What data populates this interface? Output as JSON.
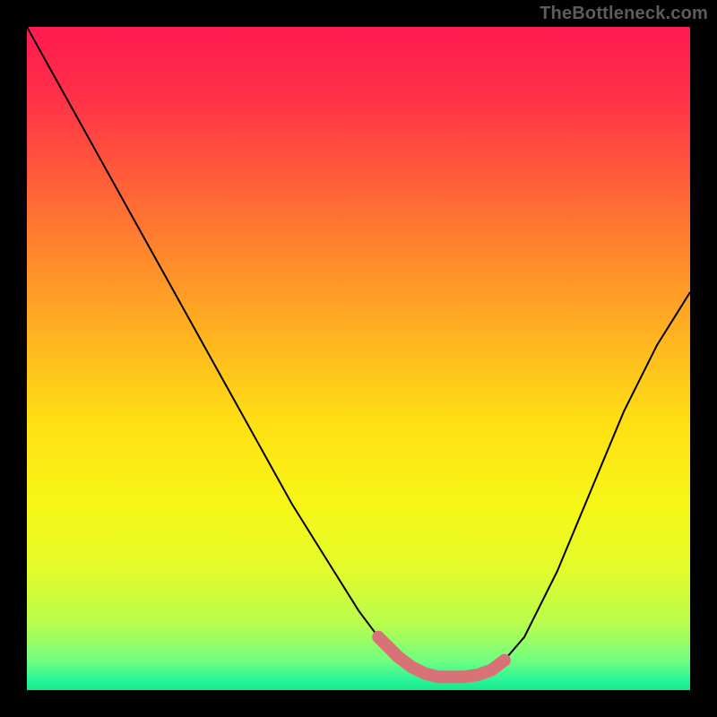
{
  "watermark": "TheBottleneck.com",
  "gradient": {
    "stops": [
      {
        "offset": 0.0,
        "color": "#ff1a50"
      },
      {
        "offset": 0.1,
        "color": "#ff2f48"
      },
      {
        "offset": 0.22,
        "color": "#ff5a3a"
      },
      {
        "offset": 0.35,
        "color": "#ff8a2c"
      },
      {
        "offset": 0.48,
        "color": "#ffb81f"
      },
      {
        "offset": 0.6,
        "color": "#ffe014"
      },
      {
        "offset": 0.72,
        "color": "#f7f716"
      },
      {
        "offset": 0.82,
        "color": "#e2fb2c"
      },
      {
        "offset": 0.9,
        "color": "#b8fd4d"
      },
      {
        "offset": 0.955,
        "color": "#72ff80"
      },
      {
        "offset": 0.985,
        "color": "#29f59a"
      },
      {
        "offset": 1.0,
        "color": "#16e986"
      }
    ]
  },
  "chart_data": {
    "type": "line",
    "title": "",
    "xlabel": "",
    "ylabel": "",
    "xlim": [
      0,
      100
    ],
    "ylim": [
      0,
      100
    ],
    "series": [
      {
        "name": "bottleneck-curve",
        "x": [
          0,
          5,
          10,
          15,
          20,
          25,
          30,
          35,
          40,
          45,
          50,
          53,
          56,
          58,
          60,
          62,
          64,
          66,
          68,
          70,
          72,
          75,
          80,
          85,
          90,
          95,
          100
        ],
        "y": [
          100,
          91,
          82,
          73,
          64,
          55,
          46,
          37,
          28,
          20,
          12,
          8,
          5,
          3.5,
          2.5,
          2,
          2,
          2,
          2.3,
          3,
          4.5,
          8,
          18,
          30,
          42,
          52,
          60
        ]
      }
    ],
    "highlight": {
      "name": "optimal-zone",
      "x": [
        53,
        56,
        58,
        60,
        62,
        64,
        66,
        68,
        70,
        72
      ],
      "y": [
        8,
        5,
        3.5,
        2.5,
        2,
        2,
        2,
        2.3,
        3,
        4.5
      ],
      "color": "#d97277",
      "dot": {
        "x": 72,
        "y": 4.5
      }
    }
  }
}
